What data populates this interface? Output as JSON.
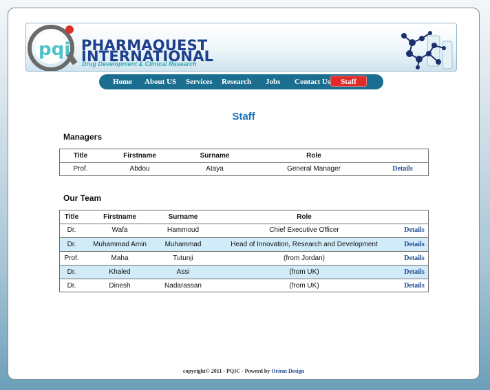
{
  "header": {
    "brand_line1": "PHARMAQUEST",
    "brand_line2": "INTERNATIONAL",
    "tagline": "Drug Development & Clinical Research",
    "logo_letters": "pqi"
  },
  "nav": {
    "items": [
      {
        "label": "Home"
      },
      {
        "label": "About US"
      },
      {
        "label": "Services"
      },
      {
        "label": "Research"
      },
      {
        "label": "Jobs"
      },
      {
        "label": "Contact Us"
      },
      {
        "label": "Staff",
        "active": true
      }
    ]
  },
  "main": {
    "title": "Staff",
    "managers": {
      "heading": "Managers",
      "columns": {
        "title": "Title",
        "firstname": "Firstname",
        "surname": "Surname",
        "role": "Role"
      },
      "rows": [
        {
          "title": "Prof.",
          "firstname": "Abdou",
          "surname": "Ataya",
          "role": "General Manager",
          "details": "Details"
        }
      ]
    },
    "team": {
      "heading": "Our Team",
      "columns": {
        "title": "Title",
        "firstname": "Firstname",
        "surname": "Surname",
        "role": "Role"
      },
      "rows": [
        {
          "title": "Dr.",
          "firstname": "Wafa",
          "surname": "Hammoud",
          "role": "Chief Executive Officer",
          "details": "Details"
        },
        {
          "title": "Dr.",
          "firstname": "Muhammad Amin",
          "surname": "Muhammad",
          "role": "Head of Innovation, Research and Development",
          "details": "Details"
        },
        {
          "title": "Prof.",
          "firstname": "Maha",
          "surname": "Tutunji",
          "role": "(from Jordan)",
          "details": "Details"
        },
        {
          "title": "Dr.",
          "firstname": "Khaled",
          "surname": "Assi",
          "role": "(from UK)",
          "details": "Details"
        },
        {
          "title": "Dr.",
          "firstname": "Dinesh",
          "surname": "Nadarassan",
          "role": "(from UK)",
          "details": "Details"
        }
      ]
    }
  },
  "footer": {
    "copyright": "copyright© 2011 - PQIC - Powerd by",
    "designer": "Orient Design"
  },
  "colors": {
    "nav_bg": "#1b6e8f",
    "nav_active": "#e12a2a",
    "title_blue": "#1a6fb9",
    "row_highlight": "#d1ebf9",
    "link": "#1d4b8f"
  }
}
